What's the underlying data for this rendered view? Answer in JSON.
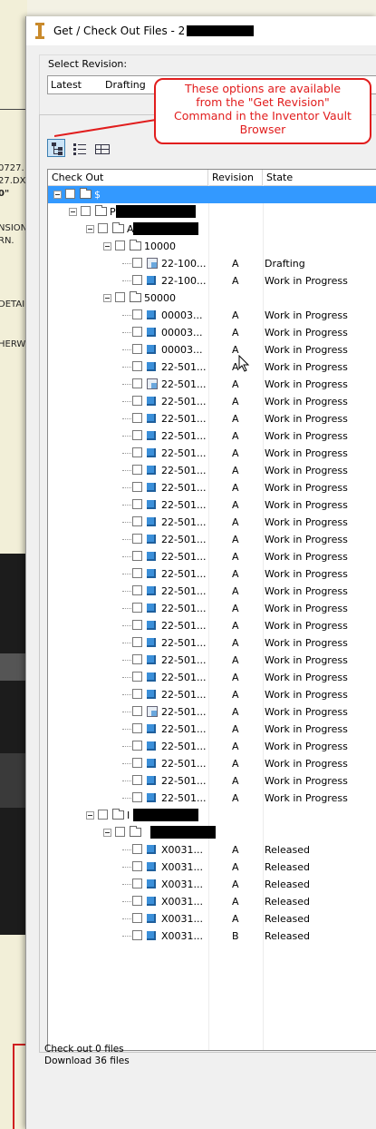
{
  "window": {
    "title": "Get / Check Out Files - 2",
    "title_redacted": true
  },
  "revision": {
    "label": "Select Revision:",
    "selected_latest": "Latest",
    "selected_state": "Drafting"
  },
  "callout": {
    "line1": "These options are available",
    "line2": "from the \"Get Revision\"",
    "line3": "Command in the Inventor Vault",
    "line4": "Browser"
  },
  "toolbar": {
    "buttons": [
      "tree-view-icon",
      "list-view-icon",
      "grid-view-icon"
    ]
  },
  "columns": {
    "checkout": "Check Out",
    "revision": "Revision",
    "state": "State"
  },
  "rows": [
    {
      "type": "folder",
      "level": 0,
      "name": "$",
      "rev": "",
      "state": "",
      "selected": true
    },
    {
      "type": "folder",
      "level": 1,
      "name": "P",
      "rev": "",
      "state": "",
      "redact": true
    },
    {
      "type": "folder",
      "level": 2,
      "name": "A",
      "rev": "",
      "state": "",
      "redact": true
    },
    {
      "type": "folder",
      "level": 3,
      "name": "10000",
      "rev": "",
      "state": ""
    },
    {
      "type": "dwg",
      "level": 4,
      "name": "22-100...",
      "rev": "A",
      "state": "Drafting"
    },
    {
      "type": "part",
      "level": 4,
      "name": "22-100...",
      "rev": "A",
      "state": "Work in Progress"
    },
    {
      "type": "folder",
      "level": 3,
      "name": "50000",
      "rev": "",
      "state": ""
    },
    {
      "type": "part",
      "level": 4,
      "name": "00003...",
      "rev": "A",
      "state": "Work in Progress"
    },
    {
      "type": "part",
      "level": 4,
      "name": "00003...",
      "rev": "A",
      "state": "Work in Progress"
    },
    {
      "type": "part",
      "level": 4,
      "name": "00003...",
      "rev": "A",
      "state": "Work in Progress"
    },
    {
      "type": "part",
      "level": 4,
      "name": "22-501...",
      "rev": "A",
      "state": "Work in Progress"
    },
    {
      "type": "dwg",
      "level": 4,
      "name": "22-501...",
      "rev": "A",
      "state": "Work in Progress"
    },
    {
      "type": "part",
      "level": 4,
      "name": "22-501...",
      "rev": "A",
      "state": "Work in Progress"
    },
    {
      "type": "part",
      "level": 4,
      "name": "22-501...",
      "rev": "A",
      "state": "Work in Progress"
    },
    {
      "type": "part",
      "level": 4,
      "name": "22-501...",
      "rev": "A",
      "state": "Work in Progress"
    },
    {
      "type": "part",
      "level": 4,
      "name": "22-501...",
      "rev": "A",
      "state": "Work in Progress"
    },
    {
      "type": "part",
      "level": 4,
      "name": "22-501...",
      "rev": "A",
      "state": "Work in Progress"
    },
    {
      "type": "part",
      "level": 4,
      "name": "22-501...",
      "rev": "A",
      "state": "Work in Progress"
    },
    {
      "type": "part",
      "level": 4,
      "name": "22-501...",
      "rev": "A",
      "state": "Work in Progress"
    },
    {
      "type": "part",
      "level": 4,
      "name": "22-501...",
      "rev": "A",
      "state": "Work in Progress"
    },
    {
      "type": "part",
      "level": 4,
      "name": "22-501...",
      "rev": "A",
      "state": "Work in Progress"
    },
    {
      "type": "part",
      "level": 4,
      "name": "22-501...",
      "rev": "A",
      "state": "Work in Progress"
    },
    {
      "type": "part",
      "level": 4,
      "name": "22-501...",
      "rev": "A",
      "state": "Work in Progress"
    },
    {
      "type": "part",
      "level": 4,
      "name": "22-501...",
      "rev": "A",
      "state": "Work in Progress"
    },
    {
      "type": "part",
      "level": 4,
      "name": "22-501...",
      "rev": "A",
      "state": "Work in Progress"
    },
    {
      "type": "part",
      "level": 4,
      "name": "22-501...",
      "rev": "A",
      "state": "Work in Progress"
    },
    {
      "type": "part",
      "level": 4,
      "name": "22-501...",
      "rev": "A",
      "state": "Work in Progress"
    },
    {
      "type": "part",
      "level": 4,
      "name": "22-501...",
      "rev": "A",
      "state": "Work in Progress"
    },
    {
      "type": "part",
      "level": 4,
      "name": "22-501...",
      "rev": "A",
      "state": "Work in Progress"
    },
    {
      "type": "part",
      "level": 4,
      "name": "22-501...",
      "rev": "A",
      "state": "Work in Progress"
    },
    {
      "type": "dwg",
      "level": 4,
      "name": "22-501...",
      "rev": "A",
      "state": "Work in Progress"
    },
    {
      "type": "part",
      "level": 4,
      "name": "22-501...",
      "rev": "A",
      "state": "Work in Progress"
    },
    {
      "type": "part",
      "level": 4,
      "name": "22-501...",
      "rev": "A",
      "state": "Work in Progress"
    },
    {
      "type": "part",
      "level": 4,
      "name": "22-501...",
      "rev": "A",
      "state": "Work in Progress"
    },
    {
      "type": "part",
      "level": 4,
      "name": "22-501...",
      "rev": "A",
      "state": "Work in Progress"
    },
    {
      "type": "part",
      "level": 4,
      "name": "22-501...",
      "rev": "A",
      "state": "Work in Progress"
    },
    {
      "type": "folder",
      "level": 2,
      "name": "I",
      "rev": "",
      "state": "",
      "redact": true
    },
    {
      "type": "folder",
      "level": 3,
      "name": "",
      "rev": "",
      "state": "",
      "redact": true
    },
    {
      "type": "part",
      "level": 4,
      "name": "X0031...",
      "rev": "A",
      "state": "Released"
    },
    {
      "type": "part",
      "level": 4,
      "name": "X0031...",
      "rev": "A",
      "state": "Released"
    },
    {
      "type": "part",
      "level": 4,
      "name": "X0031...",
      "rev": "A",
      "state": "Released"
    },
    {
      "type": "part",
      "level": 4,
      "name": "X0031...",
      "rev": "A",
      "state": "Released"
    },
    {
      "type": "part",
      "level": 4,
      "name": "X0031...",
      "rev": "A",
      "state": "Released"
    },
    {
      "type": "part",
      "level": 4,
      "name": "X0031...",
      "rev": "B",
      "state": "Released"
    }
  ],
  "status": {
    "checkout": "Check out 0 files",
    "download": "Download 36 files"
  },
  "background": {
    "lines": [
      "0727.",
      "27.DX",
      "0\"",
      "NSION",
      "RN.",
      "DETAI",
      "HERW"
    ]
  }
}
